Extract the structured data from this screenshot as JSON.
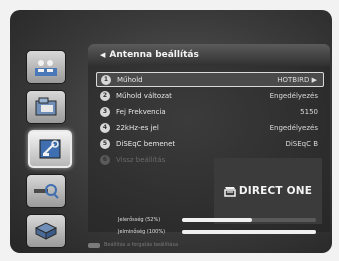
{
  "menu": {
    "title": "Antenna beállítás",
    "rows": [
      {
        "num": "1",
        "label": "Műhold",
        "value": "HOTBIRD ▶"
      },
      {
        "num": "2",
        "label": "Műhold változat",
        "value": "Engedélyezés"
      },
      {
        "num": "3",
        "label": "Fej Frekvencia",
        "value": "5150"
      },
      {
        "num": "4",
        "label": "22kHz-es jel",
        "value": "Engedélyezés"
      },
      {
        "num": "5",
        "label": "DiSEqC bemenet",
        "value": "DiSEqC B"
      },
      {
        "num": "6",
        "label": "Vissz beállítás",
        "value": ""
      }
    ]
  },
  "preview": {
    "logo_text": "DIRECT ONE"
  },
  "signal": {
    "strength_label": "Jelerősség (52%)",
    "strength_level": 0.52,
    "quality_label": "Jelminőség (100%)",
    "quality_level": 1.0
  },
  "footer": {
    "hint": "Beállítás a forgatás beállítása"
  },
  "rail": {
    "icons": [
      "settings-menu-icon",
      "media-folder-icon",
      "satellite-dish-icon",
      "tools-search-icon",
      "storage-icon"
    ],
    "active_index": 2
  },
  "colors": {
    "highlight_border": "#d9d9d9",
    "screen_bg": "#3a3a3a",
    "text": "#e8e8e8"
  }
}
